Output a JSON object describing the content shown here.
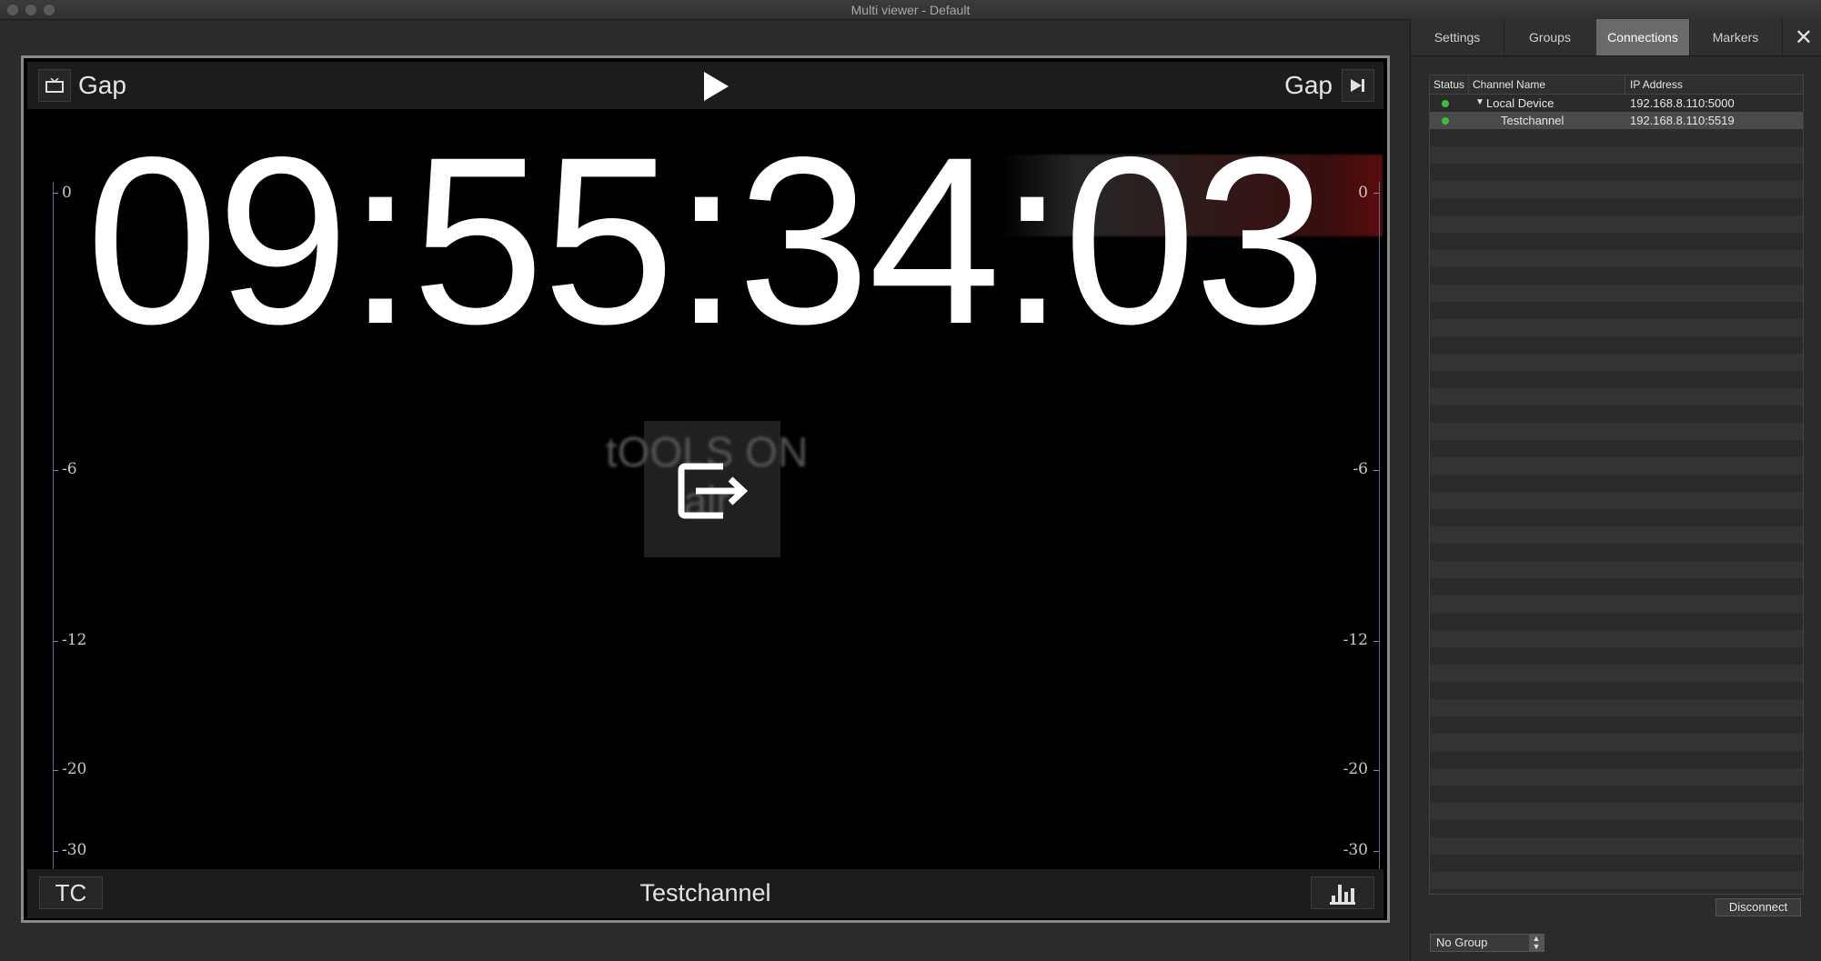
{
  "window": {
    "title": "Multi viewer - Default"
  },
  "viewer": {
    "left_label": "Gap",
    "right_label": "Gap",
    "timecode": "09:55:34:03",
    "meter_ticks": [
      "0",
      "-6",
      "-12",
      "-20",
      "-30",
      "-∞"
    ],
    "tc_button": "TC",
    "channel_name": "Testchannel",
    "background_logo_text": "tOOLS ON air",
    "background_timecode": "09:55:34"
  },
  "panel": {
    "tabs": [
      {
        "label": "Settings",
        "active": false
      },
      {
        "label": "Groups",
        "active": false
      },
      {
        "label": "Connections",
        "active": true
      },
      {
        "label": "Markers",
        "active": false
      }
    ],
    "table": {
      "headers": [
        "Status",
        "Channel Name",
        "IP Address"
      ],
      "rows": [
        {
          "status": "connected",
          "name": "Local Device",
          "ip": "192.168.8.110:5000",
          "expanded": true
        },
        {
          "status": "connected",
          "name": "Testchannel",
          "ip": "192.168.8.110:5519",
          "selected": true
        }
      ]
    },
    "disconnect_label": "Disconnect",
    "group_select_value": "No Group"
  },
  "colors": {
    "accent_active_tab": "#6a6a6a",
    "status_green": "#38c23a"
  },
  "icons": [
    "tv-icon",
    "play-icon",
    "skip-to-end-icon",
    "output-icon",
    "level-meter-icon",
    "close-icon",
    "disclosure-triangle-icon"
  ]
}
